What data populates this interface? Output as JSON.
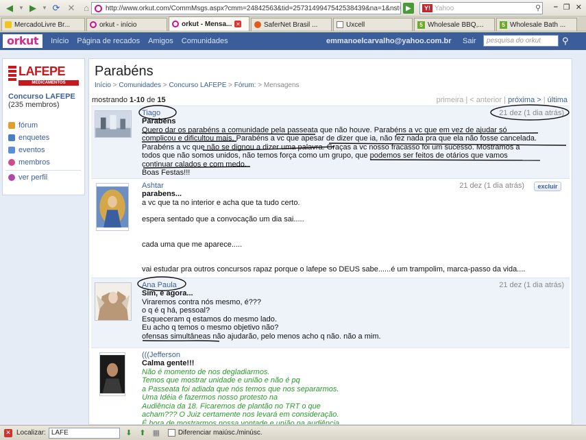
{
  "browser": {
    "url": "http://www.orkut.com/CommMsgs.aspx?cmm=24842563&tid=2573149947542538439&na=1&nst=1",
    "search_placeholder": "Yahoo",
    "yahoo_label": "Y!"
  },
  "tabs": [
    {
      "label": "MercadoLivre Br...",
      "icon": "mercadolivre-icon"
    },
    {
      "label": "orkut - início",
      "icon": "orkut-icon"
    },
    {
      "label": "orkut - Mensa...",
      "icon": "orkut-icon",
      "active": true
    },
    {
      "label": "SaferNet Brasil ...",
      "icon": "safernet-icon"
    },
    {
      "label": "Uxcell",
      "icon": "page-icon"
    },
    {
      "label": "Wholesale BBQ,...",
      "icon": "five-icon"
    },
    {
      "label": "Wholesale Bath ...",
      "icon": "five-icon"
    }
  ],
  "orkut": {
    "logo": "orkut",
    "nav": [
      "Início",
      "Página de recados",
      "Amigos",
      "Comunidades"
    ],
    "email": "emmanoelcarvalho@yahoo.com.br",
    "logout": "Sair",
    "search_placeholder": "pesquisa do orkut"
  },
  "community": {
    "logo_text": "LAFEPE",
    "logo_sub": "MEDICAMENTOS",
    "name": "Concurso LAFEPE",
    "members": "(235 membros)",
    "menu": [
      {
        "label": "fórum",
        "color": "#e0a030"
      },
      {
        "label": "enquetes",
        "color": "#4a7fc0"
      },
      {
        "label": "eventos",
        "color": "#5a8fd8"
      },
      {
        "label": "membros",
        "color": "#d24a8a"
      }
    ],
    "view_profile": "ver perfil"
  },
  "page": {
    "title": "Parabéns",
    "breadcrumb": [
      "Início",
      "Comunidades",
      "Concurso LAFEPE",
      "Fórum:",
      "Mensagens"
    ],
    "showing_prefix": "mostrando ",
    "showing_range": "1-10",
    "showing_mid": " de ",
    "showing_total": "15",
    "pager": {
      "first": "primeira",
      "prev": "< anterior",
      "next": "próxima >",
      "last": "última"
    }
  },
  "posts": [
    {
      "author": "Tiago",
      "date": "21 dez (1 dia atrás)",
      "subject": "Parabéns",
      "lines": [
        "Quero dar os parabéns a comunidade pela passeata que não houve. Parabéns a vc que em vez de ajudar só",
        "complicou e dificultou mais. Parabéns a vc que apesar de dizer que ia, não fez nada pra que ela não fosse cancelada.",
        "Parabéns a vc que não se dignou a dizer uma palavra. Graças a vc nosso fracasso foi um sucesso. Mostramos a",
        "todos que não somos unidos, não temos força como um grupo, que podemos ser feitos de otários que vamos",
        "continuar calados e com medo.",
        "Boas Festas!!!"
      ]
    },
    {
      "author": "Ashtar",
      "date": "21 dez (1 dia atrás)",
      "delete": "excluir",
      "subject": "parabens...",
      "lines": [
        "a vc que ta no interior e acha que ta tudo certo.",
        "",
        "espera sentado que a convocação um dia sai.....",
        "",
        "",
        "cada uma que me aparece.....",
        "",
        "",
        "vai estudar pra outros concursos rapaz porque o lafepe so DEUS sabe......é um trampolim, marca-passo da vida...."
      ]
    },
    {
      "author": "Ana Paula",
      "date": "21 dez (1 dia atrás)",
      "subject": "Sim, e agora...",
      "lines": [
        "Viraremos contra nós mesmo, é???",
        "o q é q há, pessoal?",
        "Esqueceram q estamos do mesmo lado.",
        "Eu acho q temos o mesmo objetivo não?",
        "ofensas simultâneas não ajudarão, pelo menos acho q não. não a mim."
      ]
    },
    {
      "author": "(((Jefferson",
      "date": "",
      "subject": "Calma gente!!!",
      "lines": [
        "Não é momento de nos degladiarmos.",
        "Temos que mostrar unidade e união e não é pq",
        "a Passeata foi adiada que nós temos que nos separarmos.",
        "Uma Idéia é fazermos nosso protesto na",
        "Audiência da 18. Ficaremos de plantão no TRT o que",
        "acham??? O Juiz certamente nos levará em consideração.",
        "É hora de mostrarmos nossa vontade e união na audiência."
      ]
    }
  ],
  "findbar": {
    "label": "Localizar:",
    "value": "LAFE",
    "match_case": "Diferenciar maiúsc./minúsc."
  }
}
